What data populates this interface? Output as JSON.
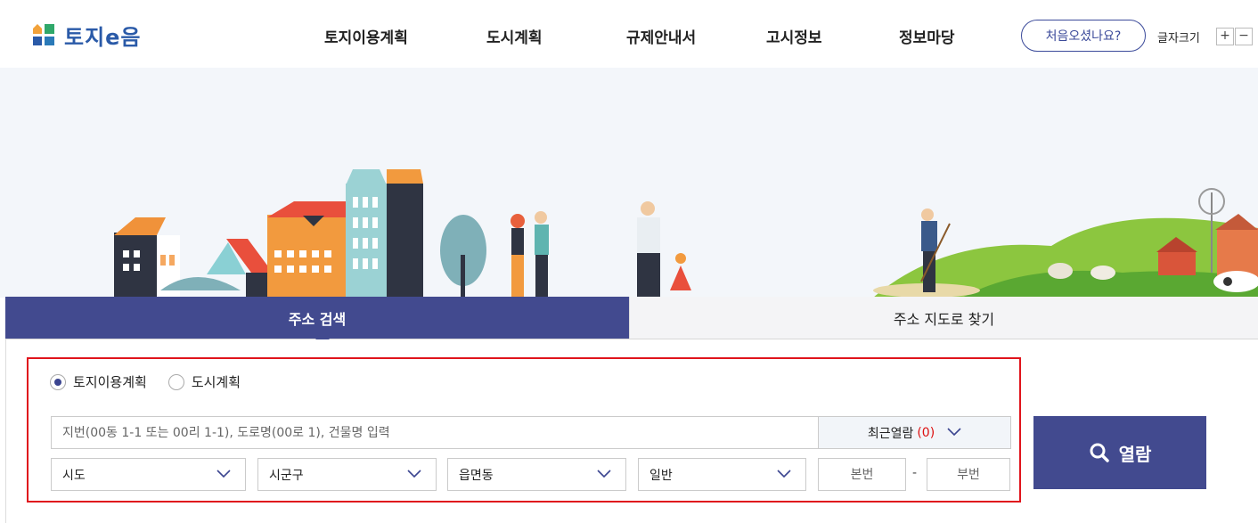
{
  "header": {
    "logo_text": "토지e음",
    "nav": [
      "토지이용계획",
      "도시계획",
      "규제안내서",
      "고시정보",
      "정보마당"
    ],
    "first_visit_label": "처음오셨나요?",
    "font_size_label": "글자크기",
    "font_plus": "+",
    "font_minus": "−"
  },
  "tabs": {
    "active": "주소 검색",
    "inactive": "주소 지도로 찾기"
  },
  "search": {
    "radio_options": [
      {
        "label": "토지이용계획",
        "checked": true
      },
      {
        "label": "도시계획",
        "checked": false
      }
    ],
    "address_placeholder": "지번(00동 1-1 또는 00리 1-1), 도로명(00로 1), 건물명 입력",
    "recent_label": "최근열람",
    "recent_count": "(0)",
    "selects": [
      "시도",
      "시군구",
      "읍면동",
      "일반"
    ],
    "main_number_placeholder": "본번",
    "dash": "-",
    "sub_number_placeholder": "부번",
    "submit_label": "열람"
  },
  "colors": {
    "primary": "#424a8f",
    "highlight_border": "#e0141c",
    "recent_count": "#dd1111"
  }
}
